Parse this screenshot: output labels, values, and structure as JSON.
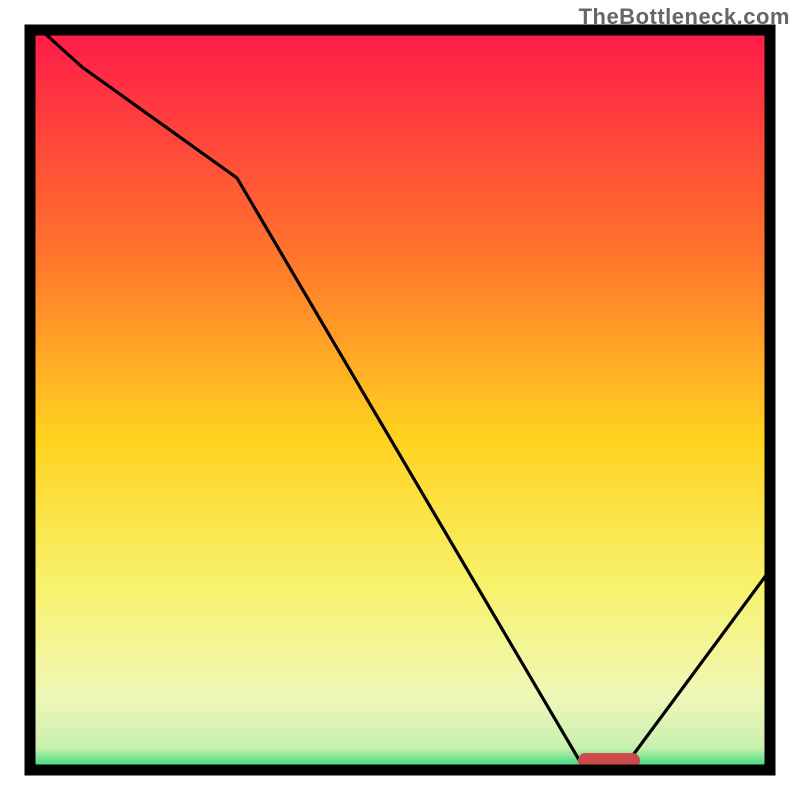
{
  "attribution": "TheBottleneck.com",
  "chart_data": {
    "type": "line",
    "title": "",
    "xlabel": "",
    "ylabel": "",
    "xlim": [
      0,
      100
    ],
    "ylim": [
      0,
      100
    ],
    "x": [
      0,
      7,
      28,
      75,
      80,
      100
    ],
    "values": [
      101,
      95,
      80,
      0,
      0,
      27
    ],
    "marker": {
      "x_start": 74,
      "x_end": 82,
      "y": 1.5
    },
    "background_gradient_stops": [
      {
        "pct": 0,
        "color": "#ff1a4a"
      },
      {
        "pct": 32,
        "color": "#ff7a2a"
      },
      {
        "pct": 55,
        "color": "#ffd21f"
      },
      {
        "pct": 75,
        "color": "#f8f26b"
      },
      {
        "pct": 90,
        "color": "#f0f7b8"
      },
      {
        "pct": 97,
        "color": "#c9f0b0"
      },
      {
        "pct": 100,
        "color": "#1fd671"
      }
    ]
  }
}
